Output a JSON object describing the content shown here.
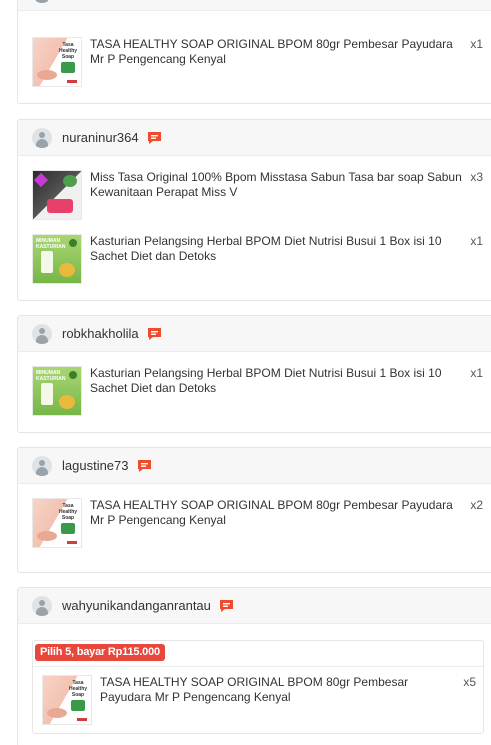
{
  "cards": [
    {
      "username": "",
      "items": [
        {
          "name": "TASA HEALTHY SOAP ORIGINAL BPOM 80gr Pembesar Payudara Mr P Pengencang Kenyal",
          "qty": "x1",
          "thumb": "tasa"
        }
      ]
    },
    {
      "username": "nuraninur364",
      "items": [
        {
          "name": "Miss Tasa Original 100% Bpom Misstasa Sabun Tasa bar soap Sabun Kewanitaan Perapat Miss V",
          "qty": "x3",
          "thumb": "miss"
        },
        {
          "name": "Kasturian Pelangsing Herbal BPOM Diet Nutrisi Busui 1 Box isi 10 Sachet Diet dan Detoks",
          "qty": "x1",
          "thumb": "kasturian"
        }
      ]
    },
    {
      "username": "robkhakholila",
      "items": [
        {
          "name": "Kasturian Pelangsing Herbal BPOM Diet Nutrisi Busui 1 Box isi 10 Sachet Diet dan Detoks",
          "qty": "x1",
          "thumb": "kasturian"
        }
      ]
    },
    {
      "username": "lagustine73",
      "items": [
        {
          "name": "TASA HEALTHY SOAP ORIGINAL BPOM 80gr Pembesar Payudara Mr P Pengencang Kenyal",
          "qty": "x2",
          "thumb": "tasa"
        }
      ]
    },
    {
      "username": "wahyunikandanganrantau",
      "promo": "Pilih 5, bayar Rp115.000",
      "items": [
        {
          "name": "TASA HEALTHY SOAP ORIGINAL BPOM 80gr Pembesar Payudara Mr P Pengencang Kenyal",
          "qty": "x5",
          "thumb": "tasa"
        }
      ]
    }
  ],
  "thumb_text": {
    "tasa": "Tasa Healthy Soap",
    "kasturian": "MINUMAN KASTURIAN"
  },
  "colors": {
    "chat_icon": "#ee4d2d",
    "promo_badge": "#e8473b"
  }
}
